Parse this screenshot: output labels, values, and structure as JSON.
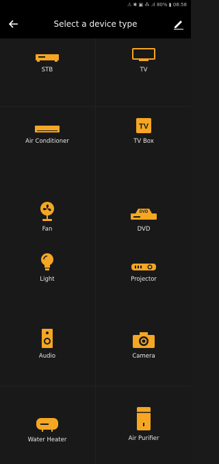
{
  "status": {
    "text": "⚠ ✱ ▣ ⁂ .ıl 80% ▮ 08:58"
  },
  "header": {
    "title": "Select a device type"
  },
  "colors": {
    "accent": "#f5a623"
  },
  "devices": [
    {
      "label": "STB",
      "icon": "stb-icon"
    },
    {
      "label": "TV",
      "icon": "tv-icon"
    },
    {
      "label": "Air Conditioner",
      "icon": "air-conditioner-icon"
    },
    {
      "label": "TV Box",
      "icon": "tv-box-icon",
      "icon_text": "TV"
    },
    {
      "label": "Fan",
      "icon": "fan-icon"
    },
    {
      "label": "DVD",
      "icon": "dvd-icon",
      "icon_text": "DVD"
    },
    {
      "label": "Light",
      "icon": "light-bulb-icon"
    },
    {
      "label": "Projector",
      "icon": "projector-icon"
    },
    {
      "label": "Audio",
      "icon": "speaker-icon"
    },
    {
      "label": "Camera",
      "icon": "camera-icon"
    },
    {
      "label": "Water Heater",
      "icon": "water-heater-icon"
    },
    {
      "label": "Air Purifier",
      "icon": "air-purifier-icon"
    }
  ]
}
